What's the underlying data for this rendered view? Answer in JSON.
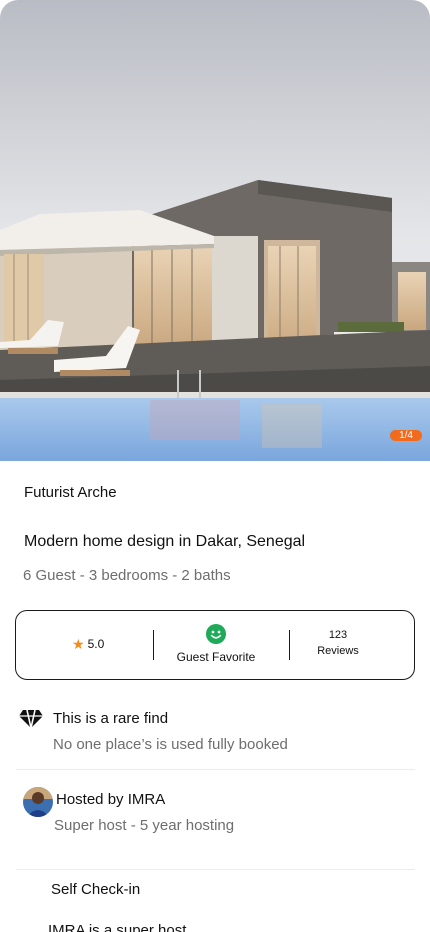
{
  "gallery": {
    "counter": "1/4"
  },
  "listing": {
    "title": "Futurist Arche",
    "subtitle": "Modern home design in Dakar, Senegal",
    "meta": "6 Guest - 3 bedrooms - 2 baths"
  },
  "stats": {
    "rating": "5.0",
    "favorite_label": "Guest Favorite",
    "reviews_count": "123",
    "reviews_label": "Reviews"
  },
  "features": {
    "rare": {
      "title": "This is a rare find",
      "subtitle": "No one place’s is used fully booked"
    },
    "host": {
      "title": "Hosted by IMRA",
      "subtitle": "Super host - 5 year hosting"
    },
    "checkin": {
      "title": "Self Check-in",
      "subtitle": "IMRA is a super host"
    }
  },
  "colors": {
    "accent": "#f26b1d",
    "star": "#f28c1a",
    "favorite": "#1faa59"
  },
  "icons": {
    "rating": "star-icon",
    "favorite": "smile-icon",
    "rare": "diamond-icon",
    "host": "avatar"
  }
}
